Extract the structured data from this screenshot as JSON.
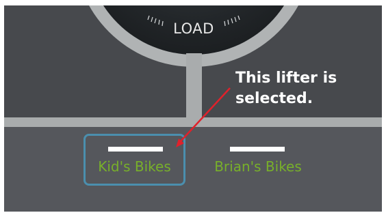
{
  "gauge": {
    "label": "LOAD"
  },
  "lifters": [
    {
      "name": "Kid's Bikes",
      "selected": true
    },
    {
      "name": "Brian's Bikes",
      "selected": false
    }
  ],
  "annotation": {
    "line1": "This lifter is",
    "line2": "selected.",
    "color": "#ffffff",
    "arrow_color": "#e0212b"
  },
  "colors": {
    "lifter_name": "#78b02a",
    "selection_border": "#4b8fae",
    "background": "#4a4c50"
  }
}
